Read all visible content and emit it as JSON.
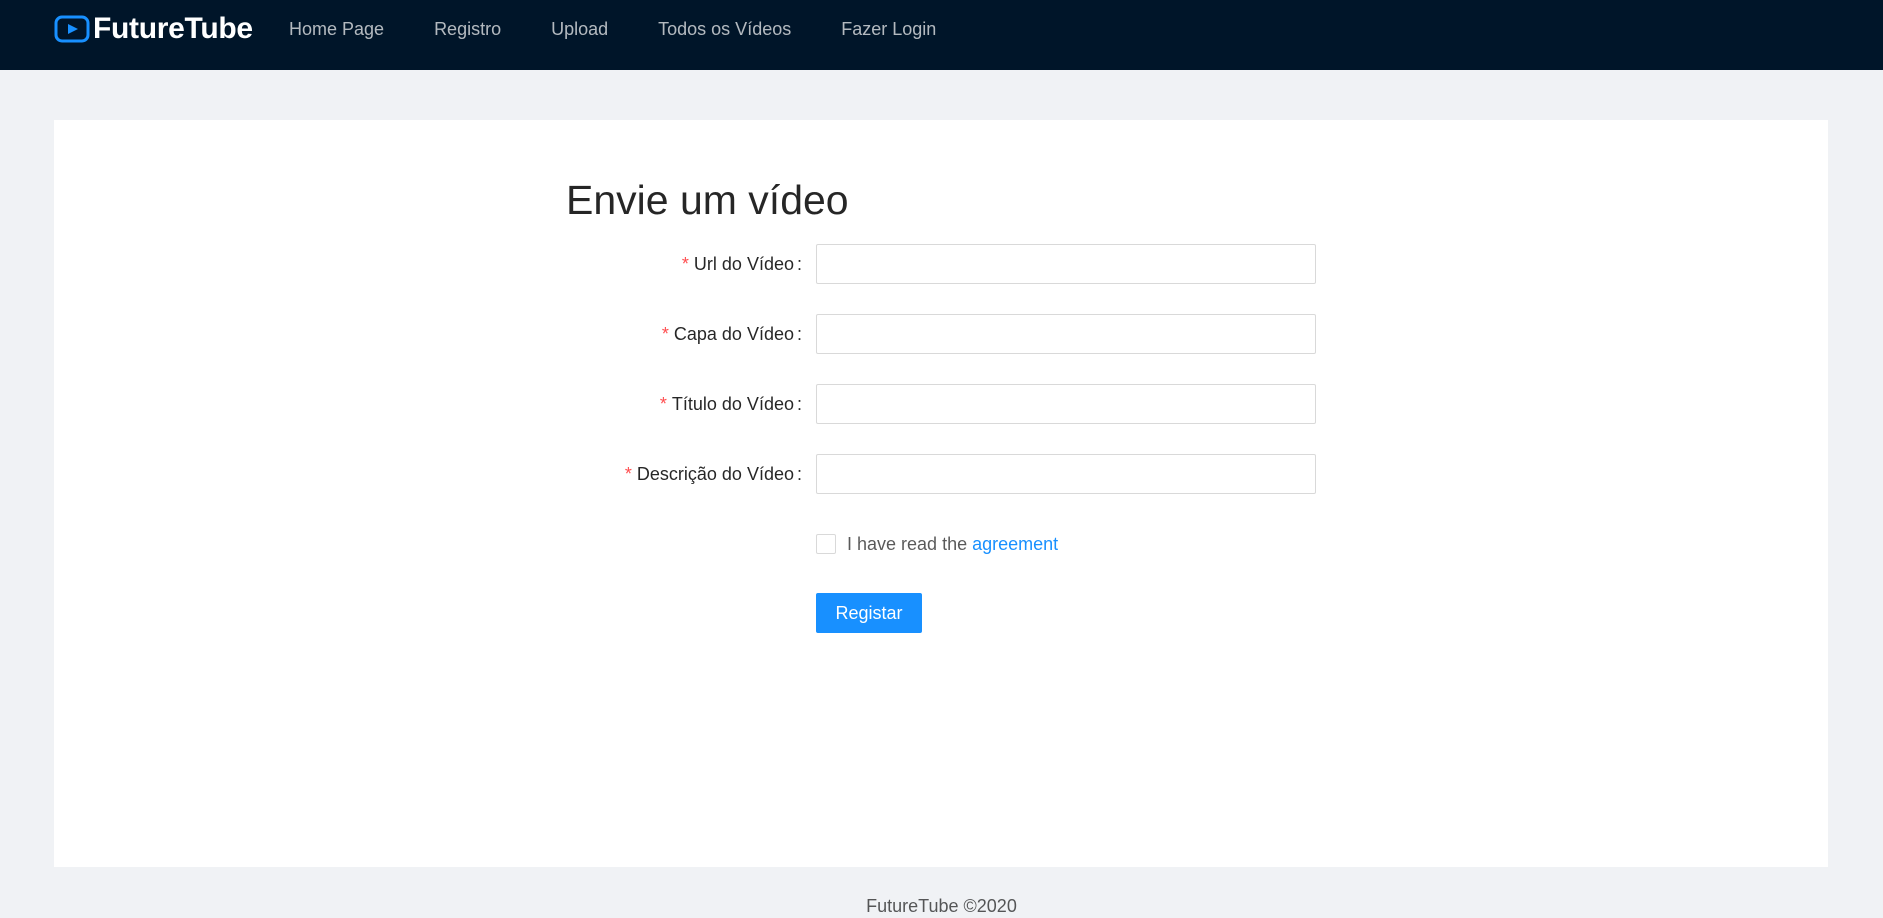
{
  "header": {
    "brand": "FutureTube",
    "logo_icon": "play-button-icon",
    "nav": [
      {
        "label": "Home Page"
      },
      {
        "label": "Registro"
      },
      {
        "label": "Upload"
      },
      {
        "label": "Todos os Vídeos"
      },
      {
        "label": "Fazer Login"
      }
    ]
  },
  "form": {
    "title": "Envie um vídeo",
    "required_mark": "*",
    "fields": [
      {
        "label": "Url do Vídeo",
        "value": ""
      },
      {
        "label": "Capa do Vídeo",
        "value": ""
      },
      {
        "label": "Título do Vídeo",
        "value": ""
      },
      {
        "label": "Descrição do Vídeo",
        "value": ""
      }
    ],
    "agreement": {
      "checked": false,
      "text": "I have read the",
      "link": "agreement"
    },
    "submit_label": "Registar"
  },
  "footer": {
    "text": "FutureTube ©2020"
  },
  "colors": {
    "header_bg": "#001529",
    "primary": "#1890ff",
    "required": "#ff4d4f",
    "page_bg": "#f0f2f5"
  }
}
